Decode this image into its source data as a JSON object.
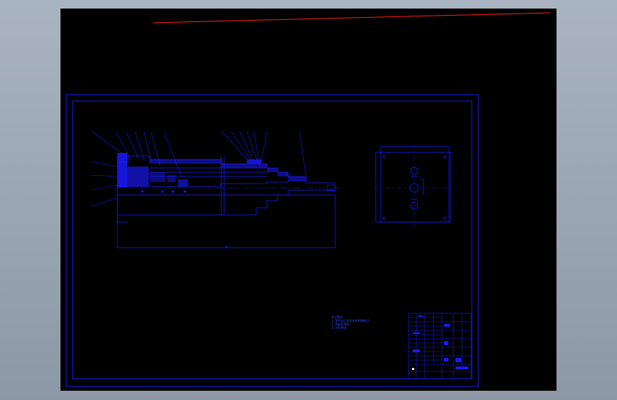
{
  "app": {
    "background": "#9aa5b2",
    "canvas_color": "#000000"
  },
  "colors": {
    "line": "#1a1aff",
    "accent_line": "#ff2020",
    "text": "#3040ff"
  },
  "technical_notes": {
    "title": "技术要求",
    "lines": [
      "1.零件加工前须去毛刺倒锐边",
      "2.装配前清洗",
      "3.涂防锈油"
    ]
  }
}
